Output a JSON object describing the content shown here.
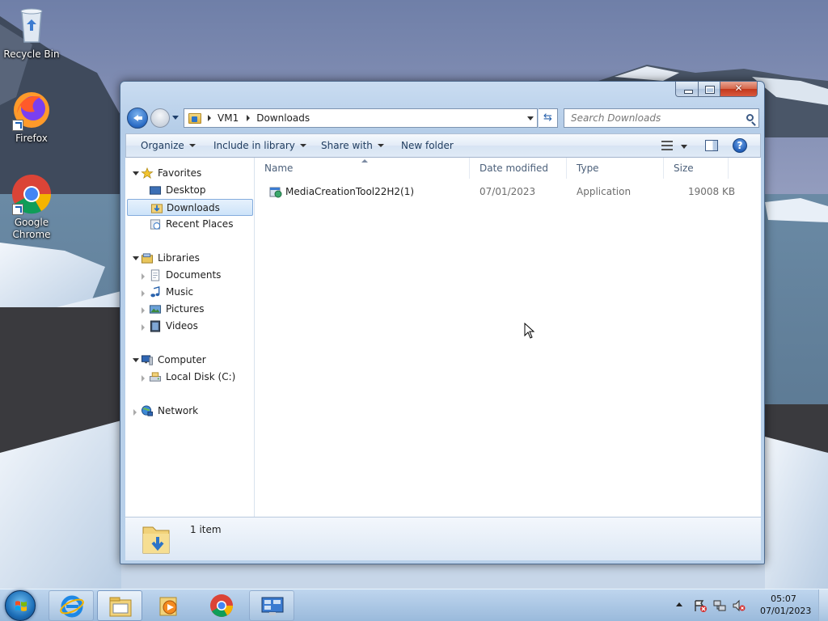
{
  "desktop": {
    "icons": [
      {
        "label": "Recycle Bin"
      },
      {
        "label": "Firefox"
      },
      {
        "label_line1": "Google",
        "label_line2": "Chrome"
      }
    ]
  },
  "explorer": {
    "address": {
      "crumbs": [
        "VM1",
        "Downloads"
      ],
      "search_placeholder": "Search Downloads"
    },
    "toolbar": {
      "organize": "Organize",
      "include_in_library": "Include in library",
      "share_with": "Share with",
      "new_folder": "New folder"
    },
    "nav": {
      "favorites": "Favorites",
      "desktop": "Desktop",
      "downloads": "Downloads",
      "recent_places": "Recent Places",
      "libraries": "Libraries",
      "documents": "Documents",
      "music": "Music",
      "pictures": "Pictures",
      "videos": "Videos",
      "computer": "Computer",
      "local_disk": "Local Disk (C:)",
      "network": "Network"
    },
    "columns": {
      "name": "Name",
      "date_modified": "Date modified",
      "type": "Type",
      "size": "Size"
    },
    "files": [
      {
        "name": "MediaCreationTool22H2(1)",
        "date": "07/01/2023",
        "type": "Application",
        "size": "19008 KB"
      }
    ],
    "details": {
      "item_count": "1 item"
    }
  },
  "taskbar": {
    "clock_time": "05:07",
    "clock_date": "07/01/2023"
  },
  "colors": {
    "selection": "#cde3f9",
    "window_frame": "#b9d1ea",
    "taskbar": "#96b9dc"
  }
}
